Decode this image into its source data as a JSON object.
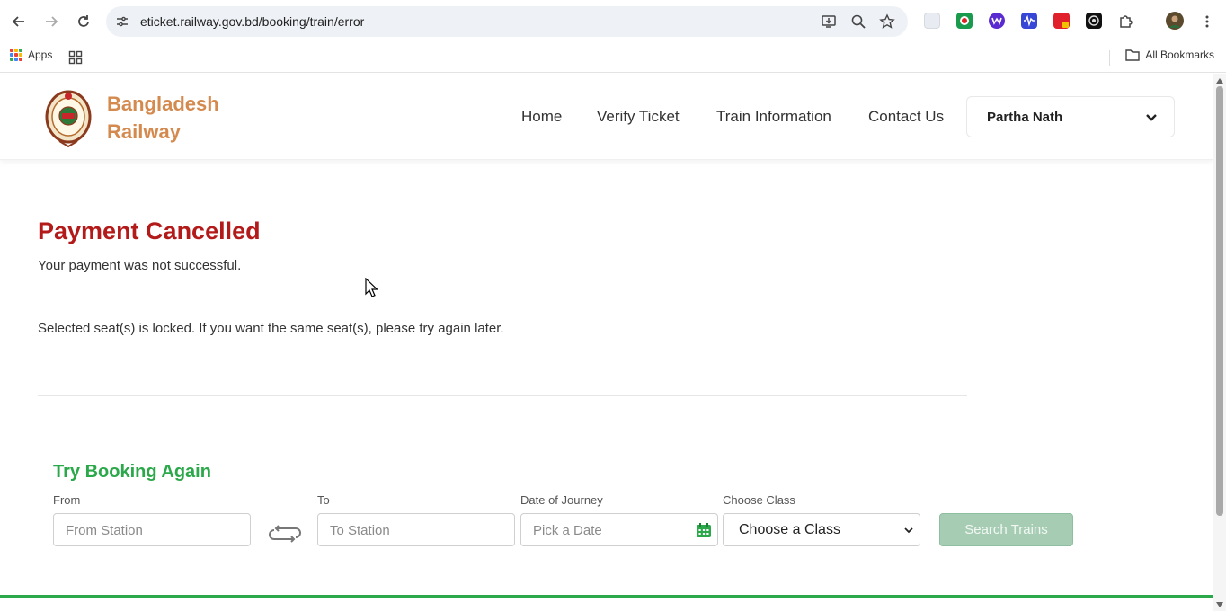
{
  "browser": {
    "url": "eticket.railway.gov.bd/booking/train/error",
    "bookmarks": {
      "apps_label": "Apps",
      "all_bookmarks_label": "All Bookmarks"
    }
  },
  "header": {
    "brand_line1": "Bangladesh",
    "brand_line2": "Railway",
    "nav": {
      "home": "Home",
      "verify_ticket": "Verify Ticket",
      "train_information": "Train Information",
      "contact_us": "Contact Us"
    },
    "user_name": "Partha Nath"
  },
  "error": {
    "title": "Payment Cancelled",
    "message": "Your payment was not successful.",
    "seat_notice": "Selected seat(s) is locked. If you want the same seat(s), please try again later."
  },
  "booking_form": {
    "heading": "Try Booking Again",
    "from_label": "From",
    "from_placeholder": "From Station",
    "to_label": "To",
    "to_placeholder": "To Station",
    "date_label": "Date of Journey",
    "date_placeholder": "Pick a Date",
    "class_label": "Choose Class",
    "class_selected": "Choose a Class",
    "search_button": "Search Trains"
  },
  "colors": {
    "brand": "#d48a4e",
    "error_title": "#b31b1b",
    "accent_green": "#2ba84a",
    "search_button_disabled": "#a6cdb4"
  }
}
